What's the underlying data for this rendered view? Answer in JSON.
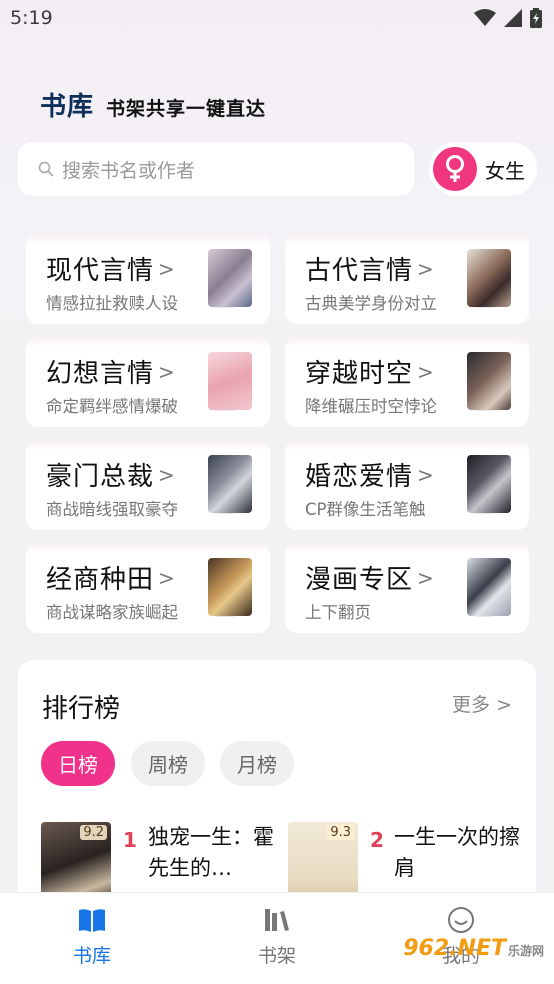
{
  "status": {
    "time": "5:19",
    "icons": [
      "wifi-icon",
      "signal-icon",
      "battery-icon"
    ]
  },
  "header": {
    "title": "书库",
    "subtitle": "书架共享一键直达"
  },
  "search": {
    "placeholder": "搜索书名或作者"
  },
  "gender": {
    "label": "女生",
    "icon": "female-icon",
    "color": "#f0367f"
  },
  "categories": [
    {
      "title": "现代言情",
      "sub": "情感拉扯救赎人设"
    },
    {
      "title": "古代言情",
      "sub": "古典美学身份对立"
    },
    {
      "title": "幻想言情",
      "sub": "命定羁绊感情爆破"
    },
    {
      "title": "穿越时空",
      "sub": "降维碾压时空悖论"
    },
    {
      "title": "豪门总裁",
      "sub": "商战暗线强取豪夺"
    },
    {
      "title": "婚恋爱情",
      "sub": "CP群像生活笔触"
    },
    {
      "title": "经商种田",
      "sub": "商战谋略家族崛起"
    },
    {
      "title": "漫画专区",
      "sub": "上下翻页"
    }
  ],
  "ranking": {
    "title": "排行榜",
    "more": "更多",
    "tabs": [
      "日榜",
      "周榜",
      "月榜"
    ],
    "active_tab": "日榜",
    "books": [
      {
        "rank": "1",
        "title": "独宠一生：霍先生的…",
        "score": "9.2"
      },
      {
        "rank": "2",
        "title": "一生一次的擦肩",
        "score": "9.3"
      }
    ]
  },
  "tabbar": {
    "items": [
      {
        "label": "书库",
        "icon": "book-open-icon",
        "active": true
      },
      {
        "label": "书架",
        "icon": "bookshelf-icon",
        "active": false
      },
      {
        "label": "我的",
        "icon": "smile-icon",
        "active": false
      }
    ]
  },
  "watermark": {
    "text": "962.NET",
    "sub": "乐游网"
  },
  "colors": {
    "accent": "#f0328a",
    "nav_active": "#1976e8",
    "title_blue": "#0d2f5a"
  }
}
